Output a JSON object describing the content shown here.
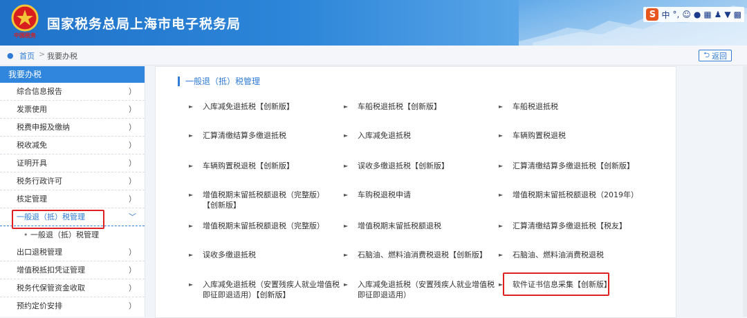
{
  "header": {
    "title": "国家税务总局上海市电子税务局",
    "emblem_text": "中国税务"
  },
  "ime": {
    "logo": "S",
    "lang": "中",
    "punct": "°,",
    "icons": [
      "smile-icon",
      "mic-icon",
      "keyboard-icon",
      "user-icon",
      "shirt-icon",
      "grid-icon"
    ]
  },
  "breadcrumb": {
    "home": "首页",
    "separator": ">",
    "current": "我要办税"
  },
  "back_button": {
    "label": "返回"
  },
  "sidebar": {
    "header": "我要办税",
    "items": [
      {
        "label": "综合信息报告"
      },
      {
        "label": "发票使用"
      },
      {
        "label": "税费申报及缴纳"
      },
      {
        "label": "税收减免"
      },
      {
        "label": "证明开具"
      },
      {
        "label": "税务行政许可"
      },
      {
        "label": "核定管理"
      },
      {
        "label": "一般退（抵）税管理"
      },
      {
        "label": "一般退（抵）税管理"
      },
      {
        "label": "出口退税管理"
      },
      {
        "label": "增值税抵扣凭证管理"
      },
      {
        "label": "税务代保管资金收取"
      },
      {
        "label": "预约定价安排"
      }
    ],
    "chevron": "）",
    "expanded_chevron": "﹀"
  },
  "main": {
    "section_title": "一般退（抵）税管理",
    "items": [
      "入库减免退抵税【创新版】",
      "车船税退抵税【创新版】",
      "车船税退抵税",
      "汇算清缴结算多缴退抵税",
      "入库减免退抵税",
      "车辆购置税退税",
      "车辆购置税退税【创新版】",
      "误收多缴退抵税【创新版】",
      "汇算清缴结算多缴退抵税【创新版】",
      "增值税期末留抵税额退税（完整版）【创新版】",
      "车购税退税申请",
      "增值税期末留抵税额退税（2019年）",
      "增值税期末留抵税额退税（完整版）",
      "增值税期末留抵税额退税",
      "汇算清缴结算多缴退抵税【税友】",
      "误收多缴退抵税",
      "石脑油、燃料油消费税退税【创新版】",
      "石脑油、燃料油消费税退税",
      "入库减免退抵税（安置残疾人就业增值税即征即退适用）【创新版】",
      "入库减免退抵税（安置残疾人就业增值税即征即退适用）",
      "软件证书信息采集【创新版】"
    ]
  },
  "colors": {
    "accent": "#2f7bd6",
    "highlight": "#e02020"
  }
}
